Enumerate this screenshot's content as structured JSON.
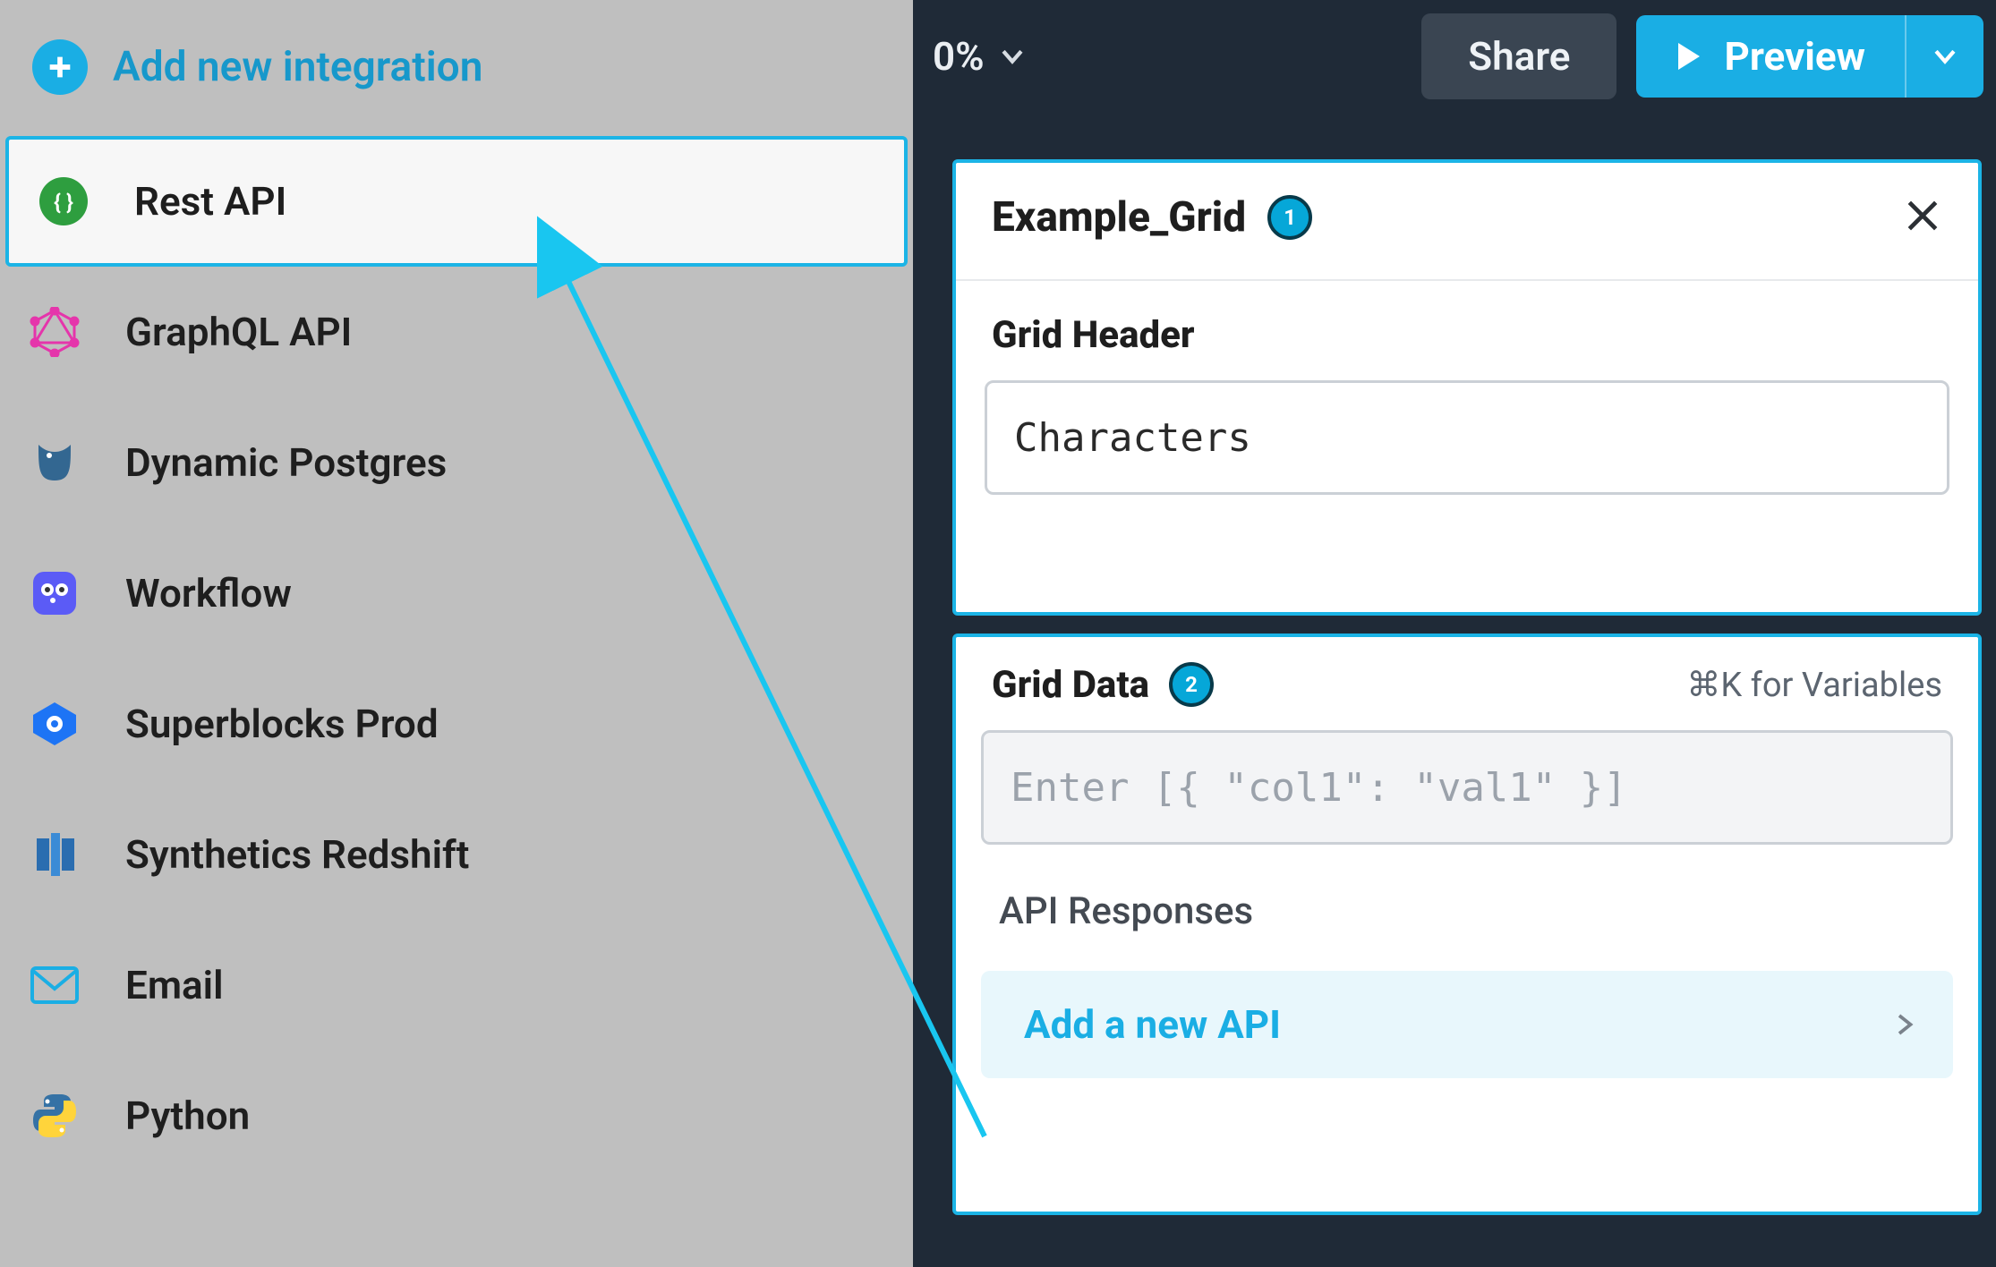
{
  "sidebar": {
    "add_label": "Add new integration",
    "items": [
      {
        "label": "Rest API",
        "selected": true
      },
      {
        "label": "GraphQL API",
        "selected": false
      },
      {
        "label": "Dynamic Postgres",
        "selected": false
      },
      {
        "label": "Workflow",
        "selected": false
      },
      {
        "label": "Superblocks Prod",
        "selected": false
      },
      {
        "label": "Synthetics Redshift",
        "selected": false
      },
      {
        "label": "Email",
        "selected": false
      },
      {
        "label": "Python",
        "selected": false
      }
    ]
  },
  "topbar": {
    "zoom": "0%",
    "share": "Share",
    "preview": "Preview"
  },
  "panel_top": {
    "title": "Example_Grid",
    "badge": "1",
    "section_label": "Grid Header",
    "value": "Characters"
  },
  "panel_bottom": {
    "title": "Grid Data",
    "badge": "2",
    "hint": "⌘K for Variables",
    "placeholder": "Enter [{ \"col1\": \"val1\" }]",
    "api_responses": "API Responses",
    "add_api": "Add a new API"
  }
}
